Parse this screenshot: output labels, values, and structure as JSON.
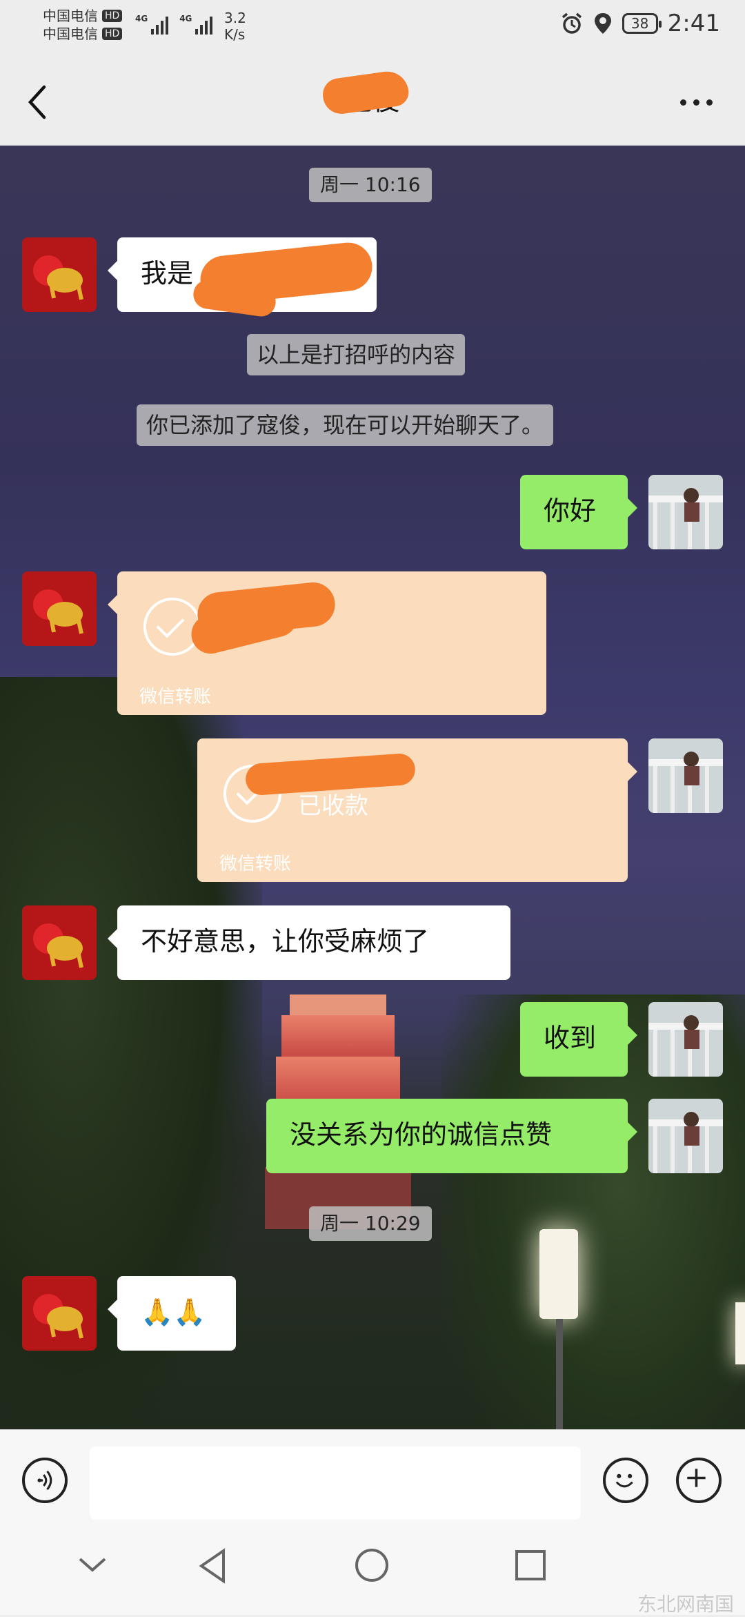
{
  "status_bar": {
    "carrier_1": "中国电信",
    "carrier_2": "中国电信",
    "hd_1": "HD",
    "hd_2": "HD",
    "net_1": "4G",
    "net_2": "4G",
    "speed_value": "3.2",
    "speed_unit": "K/s",
    "battery": "38",
    "time": "2:41",
    "icons": [
      "alarm-icon",
      "location-icon",
      "battery-icon"
    ]
  },
  "header": {
    "title": "寇俊",
    "back_icon": "chevron-left-icon",
    "more_icon": "more-dots-icon"
  },
  "messages": {
    "time_1": "周一 10:16",
    "m1_text": "我是",
    "sys_1": "以上是打招呼的内容",
    "sys_2": "你已添加了寇俊，现在可以开始聊天了。",
    "m2_text": "你好",
    "transfer_1_footer": "微信转账",
    "transfer_2_status": "已收款",
    "transfer_2_footer": "微信转账",
    "m3_text": "不好意思，让你受麻烦了",
    "m4_text": "收到",
    "m5_text": "没关系为你的诚信点赞",
    "time_2": "周一 10:29",
    "m6_text": "🙏🙏"
  },
  "input_bar": {
    "voice_icon": "voice-icon",
    "emoji_icon": "emoji-icon",
    "plus_icon": "plus-icon",
    "input_value": ""
  },
  "nav_bar": {
    "icons": [
      "collapse-icon",
      "back-triangle-icon",
      "home-circle-icon",
      "recents-square-icon"
    ]
  },
  "watermark": "东北网南国"
}
